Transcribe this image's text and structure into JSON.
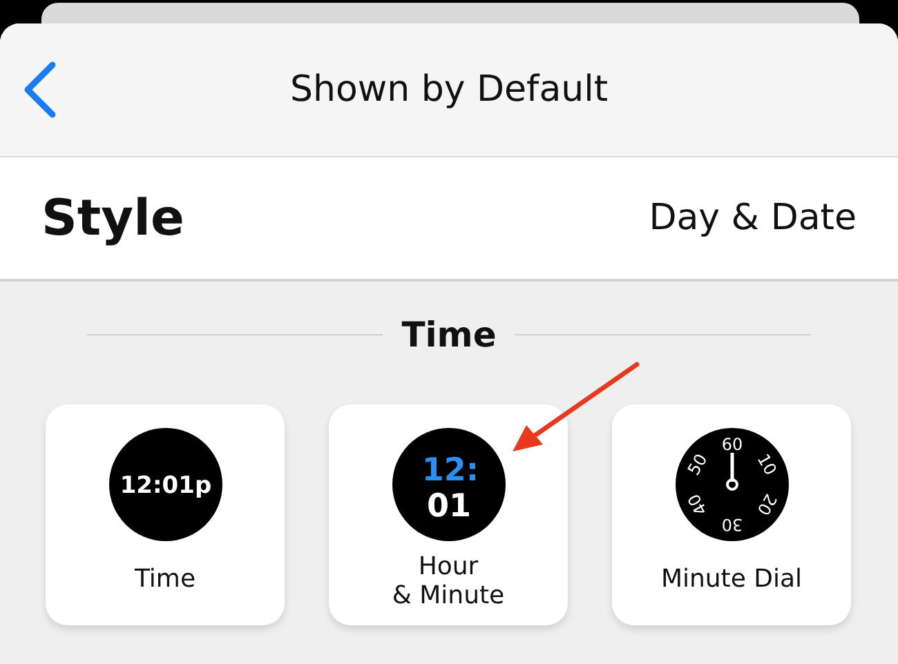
{
  "header": {
    "title": "Shown by Default"
  },
  "style_row": {
    "label": "Style",
    "value": "Day & Date"
  },
  "section": {
    "title": "Time"
  },
  "options": [
    {
      "kind": "digital",
      "face_text": [
        "12:01p"
      ],
      "label": "Time"
    },
    {
      "kind": "stacked",
      "face_text": [
        "12:",
        "01"
      ],
      "label": "Hour\n& Minute"
    },
    {
      "kind": "dial",
      "face_text": [
        "60",
        "10",
        "20",
        "30",
        "40",
        "50"
      ],
      "label": "Minute Dial"
    }
  ]
}
